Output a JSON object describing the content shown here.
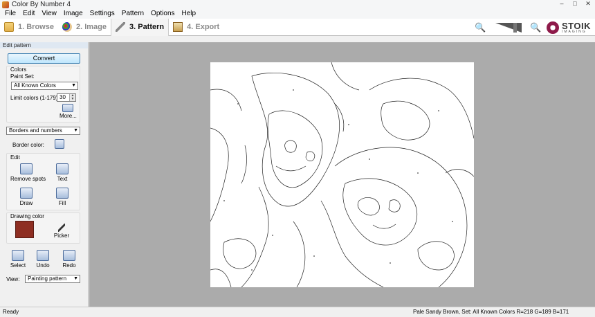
{
  "window": {
    "title": "Color By Number 4",
    "minimize": "–",
    "maximize": "□",
    "close": "✕"
  },
  "menu": [
    "File",
    "Edit",
    "View",
    "Image",
    "Settings",
    "Pattern",
    "Options",
    "Help"
  ],
  "steps": [
    {
      "label": "1. Browse",
      "icon": "folder-icon"
    },
    {
      "label": "2. Image",
      "icon": "palette-icon"
    },
    {
      "label": "3. Pattern",
      "icon": "pencil-icon",
      "active": true
    },
    {
      "label": "4. Export",
      "icon": "easel-icon"
    }
  ],
  "toolbar": {
    "zoom_out_icon": "zoom-out-icon",
    "zoom_in_icon": "zoom-in-icon",
    "brand": {
      "name": "STOIK",
      "sub": "IMAGING"
    }
  },
  "panel": {
    "header": "Edit pattern",
    "convert_label": "Convert",
    "colors": {
      "title": "Colors",
      "paint_set_label": "Paint Set:",
      "paint_set_value": "All Known Colors",
      "limit_label": "Limit colors (1-179):",
      "limit_value": "30",
      "more_label": "More..."
    },
    "borders": {
      "mode_value": "Borders and numbers",
      "border_color_label": "Border color:"
    },
    "edit": {
      "title": "Edit",
      "tools": [
        "Remove spots",
        "Text",
        "Draw",
        "Fill"
      ]
    },
    "drawing": {
      "title": "Drawing color",
      "swatch_color": "#8e2e22",
      "picker_label": "Picker"
    },
    "actions": [
      "Select",
      "Undo",
      "Redo"
    ],
    "view": {
      "label": "View:",
      "value": "Painting pattern"
    }
  },
  "status": {
    "left": "Ready",
    "right": "Pale Sandy Brown,  Set: All Known Colors R=218 G=189 B=171"
  }
}
